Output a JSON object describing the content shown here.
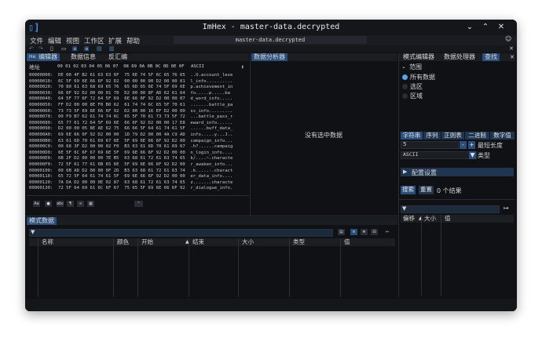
{
  "window": {
    "title": "ImHex - master-data.decrypted",
    "file_tab": "master-data.decrypted"
  },
  "menu": [
    "文件",
    "编辑",
    "视图",
    "工作区",
    "扩展",
    "帮助"
  ],
  "hex_editor": {
    "tabs": [
      "编辑器",
      "数据信息",
      "反汇编"
    ],
    "tab_icon": "Hex",
    "header": {
      "addr": "地址",
      "cols": "00 01 02 03 04 05 06 07  08 09 0A 0B 0C 0D 0E 0F",
      "ascii": "ASCII"
    },
    "rows": [
      "00000000:  DE 00 4F B2 61 63 63 6F  75 6E 74 5F 6C 65 76 65  ..O.account_leve",
      "00000010:  6C 5F 69 6E 66 6F 92 D2  00 00 00 00 D2 00 00 01  l_info..........",
      "00000020:  70 80 61 63 68 69 65 76  65 6D 65 6E 74 5F 69 6E  p.achievement_in",
      "00000030:  66 6F 92 D2 00 00 01 70  D2 00 00 8F AD 62 61 64  fo.....p.....ba",
      "00000040:  64 5F 77 6F 72 64 5F 69  6E 66 6F 92 D2 00 00 07  d_word_info.....",
      "00000050:  FF D2 00 00 8E F0 B0 62  61 74 74 6C 65 5F 70 61  .......battle_pa",
      "00000060:  73 73 5F 69 6E 66 6F 92  D2 00 00 16 EF D2 00 00  ss_info.........",
      "00000070:  00 F9 B7 62 61 74 74 6C  65 5F 70 61 73 73 5F 72  ...battle_pass_r",
      "00000080:  65 77 61 72 64 5F 69 6E  66 6F 92 D2 00 00 17 E8  eward_info......",
      "00000090:  D2 00 00 05 8E AE 62 75  66 66 5F 64 61 74 61 5F  ......buff_data_",
      "000000A0:  69 6E 66 6F 92 D2 00 00  1D 79 D2 00 00 4A C9 AD  info.....y...J..",
      "000000B0:  63 61 6D 70 61 69 67 6E  5F 69 6E 66 6F 92 D2 00  campaign_info...",
      "000000C0:  00 68 3F D2 00 00 02 F0  B3 63 61 6D 70 61 69 67  .h?......campaig",
      "000000D0:  6E 5F 6C 6F 67 69 6E 5F  69 6E 66 6F 92 D2 00 00  n_login_info....",
      "000000E0:  6B 2F D2 00 00 00 7E B5  63 68 61 72 61 63 74 65  k/....~.characte",
      "000000F0:  72 5F 61 77 61 6B 65 6E  5F 69 6E 66 6F 92 D2 00  r_awaken_info...",
      "00000100:  00 6B AD D2 00 00 0F 2D  B3 63 68 61 72 61 63 74  .k.....-.charact",
      "00000110:  65 72 5F 64 61 74 61 5F  69 6E 66 6F 92 D2 00 00  er_data_info....",
      "00000120:  7A DA D2 00 00 0E 02 87  63 68 61 72 61 63 74 65  z.......characte",
      "00000130:  72 5F 64 69 61 6C 6F 67  75 65 5F 69 6E 66 6F 92  r_dialogue_info."
    ],
    "bottom_icons": [
      "Aa",
      "bulb-icon",
      "abc",
      "paragraph-icon",
      "binoculars-icon",
      "grid-icon"
    ],
    "expand_icon": "double-chevron-up-icon"
  },
  "data_analyzer": {
    "tab": "数据分析器",
    "empty_text": "没有选中数据"
  },
  "pattern_data": {
    "tab": "模式数据",
    "columns": [
      "名称",
      "颜色",
      "开始",
      "结束",
      "大小",
      "类型",
      "值"
    ],
    "sort_marker": "▲"
  },
  "right_panel": {
    "tabs": [
      "模式编辑器",
      "数据处理器",
      "查找"
    ],
    "scope_label": "范围",
    "scope_options": [
      "所有数据",
      "选区",
      "区域"
    ],
    "scope_selected": 0,
    "search_modes": [
      "字符串",
      "序列",
      "正则表",
      "二进制",
      "数字值"
    ],
    "min_length_value": "5",
    "min_length_label": "最短长度",
    "type_value": "ASCII",
    "type_label": "类型",
    "settings_label": "配置设置",
    "search_button": "搜索",
    "reset_button": "重置",
    "result_count": "0 个结果",
    "results_columns": [
      "偏移",
      "大小",
      "值"
    ],
    "sort_marker": "▲"
  },
  "colors": {
    "accent": "#2a4d7a",
    "background": "#0f1013",
    "highlight": "#3f8fe0"
  }
}
